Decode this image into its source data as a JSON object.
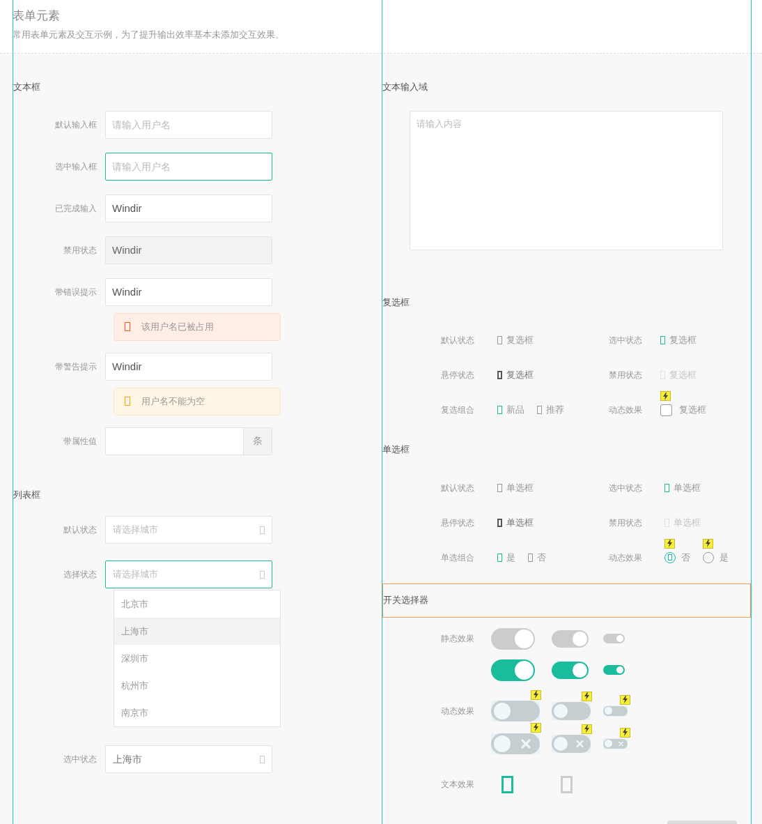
{
  "header": {
    "title": "表单元素",
    "subtitle": "常用表单元素及交互示例，为了提升输出效率基本未添加交互效果。"
  },
  "text_inputs": {
    "title": "文本框",
    "rows": [
      {
        "label": "默认输入框",
        "kind": "input",
        "placeholder": "请输入用户名",
        "focused": false,
        "disabled": false
      },
      {
        "label": "选中输入框",
        "kind": "input",
        "placeholder": "请输入用户名",
        "focused": true,
        "disabled": false
      },
      {
        "label": "已完成输入",
        "kind": "input",
        "value": "Windir",
        "focused": false,
        "disabled": false
      },
      {
        "label": "禁用状态",
        "kind": "input",
        "value": "Windir",
        "focused": false,
        "disabled": true
      },
      {
        "label": "带错误提示",
        "kind": "input",
        "value": "Windir",
        "focused": false,
        "disabled": false,
        "message": {
          "kind": "error",
          "text": "该用户名已被占用"
        }
      },
      {
        "label": "带警告提示",
        "kind": "input",
        "value": "Windir",
        "focused": false,
        "disabled": false,
        "message": {
          "kind": "warning",
          "text": "用户名不能为空"
        }
      },
      {
        "label": "带属性值",
        "kind": "addon",
        "addon": "条",
        "focused": false,
        "disabled": false
      }
    ]
  },
  "selects": {
    "title": "列表框",
    "rows": [
      {
        "label": "默认状态",
        "placeholder": "请选择城市",
        "focused": false
      },
      {
        "label": "选择状态",
        "placeholder": "请选择城市",
        "focused": true,
        "options": [
          {
            "label": "北京市",
            "selected": false
          },
          {
            "label": "上海市",
            "selected": true
          },
          {
            "label": "深圳市",
            "selected": false
          },
          {
            "label": "杭州市",
            "selected": false
          },
          {
            "label": "南京市",
            "selected": false
          }
        ]
      },
      {
        "label": "选中状态",
        "value": "上海市",
        "focused": false
      }
    ]
  },
  "textarea": {
    "title": "文本输入域",
    "placeholder": "请输入内容"
  },
  "checkboxes": {
    "title": "复选框",
    "cells": [
      {
        "label": "默认状态",
        "items": [
          {
            "text": "复选框",
            "kind": "plain",
            "checked": false,
            "hovered": false,
            "disabled": false
          }
        ]
      },
      {
        "label": "选中状态",
        "items": [
          {
            "text": "复选框",
            "kind": "plain",
            "checked": true,
            "hovered": false,
            "disabled": false
          }
        ]
      },
      {
        "label": "悬停状态",
        "items": [
          {
            "text": "复选框",
            "kind": "plain",
            "checked": false,
            "hovered": true,
            "disabled": false
          }
        ]
      },
      {
        "label": "禁用状态",
        "items": [
          {
            "text": "复选框",
            "kind": "plain",
            "checked": false,
            "hovered": false,
            "disabled": true
          }
        ]
      },
      {
        "label": "复选组合",
        "items": [
          {
            "text": "新品",
            "kind": "plain",
            "checked": true,
            "hovered": false,
            "disabled": false
          },
          {
            "text": "推荐",
            "kind": "plain",
            "checked": false,
            "hovered": false,
            "disabled": false
          }
        ]
      },
      {
        "label": "动态效果",
        "items": [
          {
            "text": "复选框",
            "kind": "dynamic",
            "checked": false,
            "hovered": false,
            "disabled": false
          }
        ]
      }
    ]
  },
  "radios": {
    "title": "单选框",
    "cells": [
      {
        "label": "默认状态",
        "items": [
          {
            "text": "单选框",
            "kind": "plain",
            "checked": false,
            "hovered": false,
            "disabled": false
          }
        ]
      },
      {
        "label": "选中状态",
        "items": [
          {
            "text": "单选框",
            "kind": "plain",
            "checked": true,
            "hovered": false,
            "disabled": false
          }
        ]
      },
      {
        "label": "悬停状态",
        "items": [
          {
            "text": "单选框",
            "kind": "plain",
            "checked": false,
            "hovered": true,
            "disabled": false
          }
        ]
      },
      {
        "label": "禁用状态",
        "items": [
          {
            "text": "单选框",
            "kind": "plain",
            "checked": false,
            "hovered": false,
            "disabled": true
          }
        ]
      },
      {
        "label": "单选组合",
        "items": [
          {
            "text": "是",
            "kind": "plain",
            "checked": true,
            "hovered": false,
            "disabled": false
          },
          {
            "text": "否",
            "kind": "plain",
            "checked": false,
            "hovered": false,
            "disabled": false
          }
        ]
      },
      {
        "label": "动态效果",
        "items": [
          {
            "text": "否",
            "kind": "dynamic",
            "checked": true,
            "hovered": false,
            "disabled": false
          },
          {
            "text": "是",
            "kind": "dynamic",
            "checked": false,
            "hovered": false,
            "disabled": false
          }
        ]
      }
    ]
  },
  "switches": {
    "title": "开关选择器",
    "rows": [
      {
        "label": "静态效果",
        "kind": "static",
        "switches": [
          {
            "kind": "large",
            "on": true,
            "disabled": true
          },
          {
            "kind": "medium",
            "on": true,
            "disabled": true
          },
          {
            "kind": "small",
            "on": true,
            "disabled": true
          }
        ]
      },
      {
        "kind": "static",
        "switches": [
          {
            "kind": "large",
            "on": true,
            "disabled": false
          },
          {
            "kind": "medium",
            "on": true,
            "disabled": false
          },
          {
            "kind": "small",
            "on": true,
            "disabled": false
          }
        ]
      },
      {
        "label": "动态效果",
        "kind": "slide",
        "switches": [
          {
            "kind": "large",
            "on": false,
            "disabled": false
          },
          {
            "kind": "medium",
            "on": false,
            "disabled": false
          },
          {
            "kind": "small",
            "on": false,
            "disabled": false
          }
        ]
      },
      {
        "kind": "cross",
        "switches": [
          {
            "kind": "large",
            "on": false,
            "disabled": false
          },
          {
            "kind": "medium",
            "on": false,
            "disabled": false
          },
          {
            "kind": "small",
            "on": false,
            "disabled": false
          }
        ]
      }
    ],
    "text_effect": {
      "label": "文本效果",
      "icons": [
        {
          "on": true
        },
        {
          "on": false
        }
      ]
    }
  }
}
